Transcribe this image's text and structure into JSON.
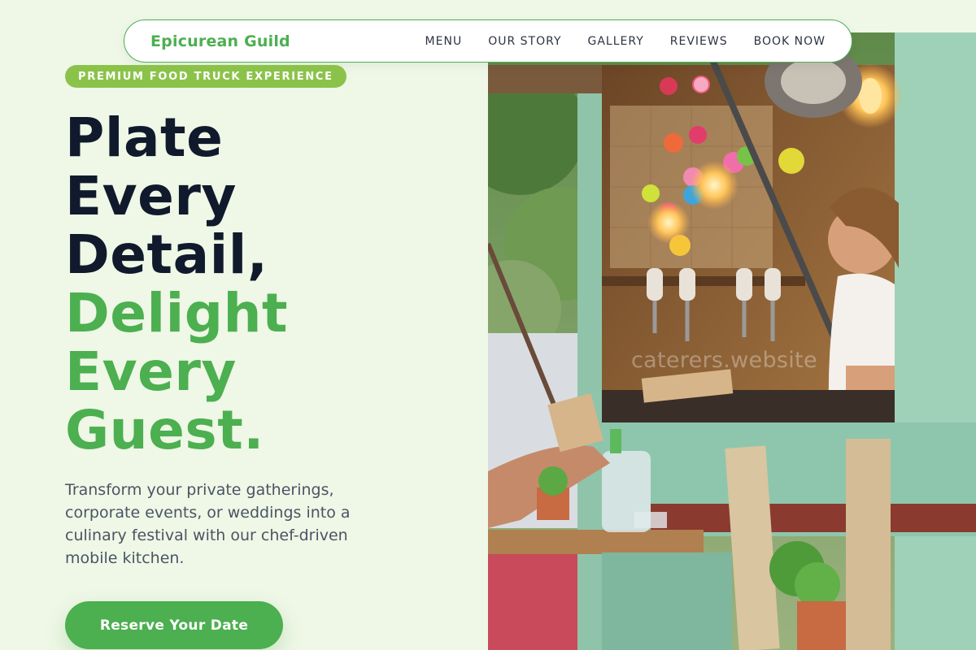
{
  "nav": {
    "brand": "Epicurean Guild",
    "links": [
      "MENU",
      "OUR STORY",
      "GALLERY",
      "REVIEWS",
      "BOOK NOW"
    ]
  },
  "hero": {
    "badge": "PREMIUM FOOD TRUCK EXPERIENCE",
    "headline_dark": [
      "Plate",
      "Every",
      "Detail,"
    ],
    "headline_green": [
      "Delight",
      "Every",
      "Guest."
    ],
    "subcopy": "Transform your private gatherings, corporate events, or weddings into a culinary festival with our chef-driven mobile kitchen.",
    "cta_label": "Reserve Your Date",
    "image_watermark": "caterers.website"
  },
  "colors": {
    "background": "#eff7e6",
    "brand_green": "#4caf50",
    "badge_green": "#8bc34a",
    "headline_dark": "#101a2c",
    "body_text": "#4a5565"
  }
}
